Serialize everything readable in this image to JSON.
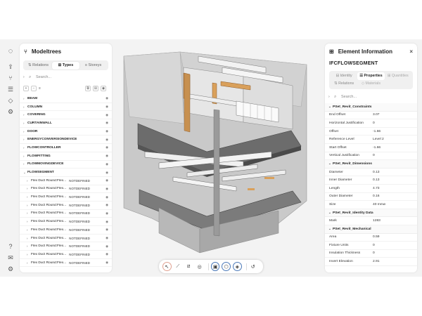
{
  "left_panel": {
    "title": "Modeltrees",
    "tabs": [
      "Relations",
      "Types",
      "Storeys"
    ],
    "active_tab": 1,
    "search_placeholder": "Search...",
    "types": [
      {
        "name": "BEAM"
      },
      {
        "name": "COLUMN"
      },
      {
        "name": "COVERING"
      },
      {
        "name": "CURTAINWALL"
      },
      {
        "name": "DOOR"
      },
      {
        "name": "ENERGYCONVERSIONDEVICE"
      },
      {
        "name": "FLOWCONTROLLER"
      },
      {
        "name": "FLOWFITTING"
      },
      {
        "name": "FLOWMOVINGDEVICE"
      },
      {
        "name": "FLOWSEGMENT"
      }
    ],
    "children": [
      {
        "name": "Flex Duct Round:Flex...",
        "value": "NOTDEFINED"
      },
      {
        "name": "Flex Duct Round:Flex...",
        "value": "NOTDEFINED"
      },
      {
        "name": "Flex Duct Round:Flex...",
        "value": "NOTDEFINED"
      },
      {
        "name": "Flex Duct Round:Flex...",
        "value": "NOTDEFINED"
      },
      {
        "name": "Flex Duct Round:Flex...",
        "value": "NOTDEFINED"
      },
      {
        "name": "Flex Duct Round:Flex...",
        "value": "NOTDEFINED"
      },
      {
        "name": "Flex Duct Round:Flex...",
        "value": "NOTDEFINED"
      },
      {
        "name": "Flex Duct Round:Flex...",
        "value": "NOTDEFINED"
      },
      {
        "name": "Flex Duct Round:Flex...",
        "value": "NOTDEFINED"
      },
      {
        "name": "Flex Duct Round:Flex...",
        "value": "NOTDEFINED"
      },
      {
        "name": "Flex Duct Round:Flex...",
        "value": "NOTDEFINED"
      }
    ]
  },
  "right_panel": {
    "title": "Element Information",
    "entity": "IFCFLOWSEGMENT",
    "tabs": [
      "Identity",
      "Properties",
      "Quantities",
      "Relations",
      "Materials"
    ],
    "psets": [
      {
        "name": "PSet_Revit_Constraints",
        "rows": [
          {
            "k": "End Offset",
            "v": "3.07"
          },
          {
            "k": "Horizontal Justification",
            "v": "0"
          },
          {
            "k": "Offset",
            "v": "-1.66"
          },
          {
            "k": "Reference Level",
            "v": "Level 2"
          },
          {
            "k": "Start Offset",
            "v": "-1.66"
          },
          {
            "k": "Vertical Justification",
            "v": "0"
          }
        ]
      },
      {
        "name": "PSet_Revit_Dimensions",
        "rows": [
          {
            "k": "Diameter",
            "v": "0.13"
          },
          {
            "k": "Inner Diameter",
            "v": "0.13"
          },
          {
            "k": "Length",
            "v": "4.73"
          },
          {
            "k": "Outer Diameter",
            "v": "0.16"
          },
          {
            "k": "Size",
            "v": "40 mmø"
          }
        ]
      },
      {
        "name": "PSet_Revit_Identity Data",
        "rows": [
          {
            "k": "Mark",
            "v": "1283"
          }
        ]
      },
      {
        "name": "PSet_Revit_Mechanical",
        "rows": [
          {
            "k": "Area",
            "v": "0.59"
          },
          {
            "k": "Fixture Units",
            "v": "0"
          },
          {
            "k": "Insulation Thickness",
            "v": "0"
          },
          {
            "k": "Invert Elevation",
            "v": "2.91"
          }
        ]
      }
    ]
  },
  "colors": {
    "accent": "#4a78b8",
    "panel": "#ffffff",
    "background": "#f3f3f3",
    "timber": "#d9a05b"
  },
  "icons": {
    "rail": [
      "logo-icon",
      "upload-icon",
      "hierarchy-icon",
      "list-icon",
      "layers-icon",
      "settings-icon",
      "help-icon",
      "mail-icon",
      "gear-icon"
    ],
    "toolbar": [
      "select-icon",
      "measure-icon",
      "section-icon",
      "camera-icon",
      "view-front-icon",
      "view-iso-icon",
      "view-top-icon",
      "undo-icon"
    ]
  }
}
